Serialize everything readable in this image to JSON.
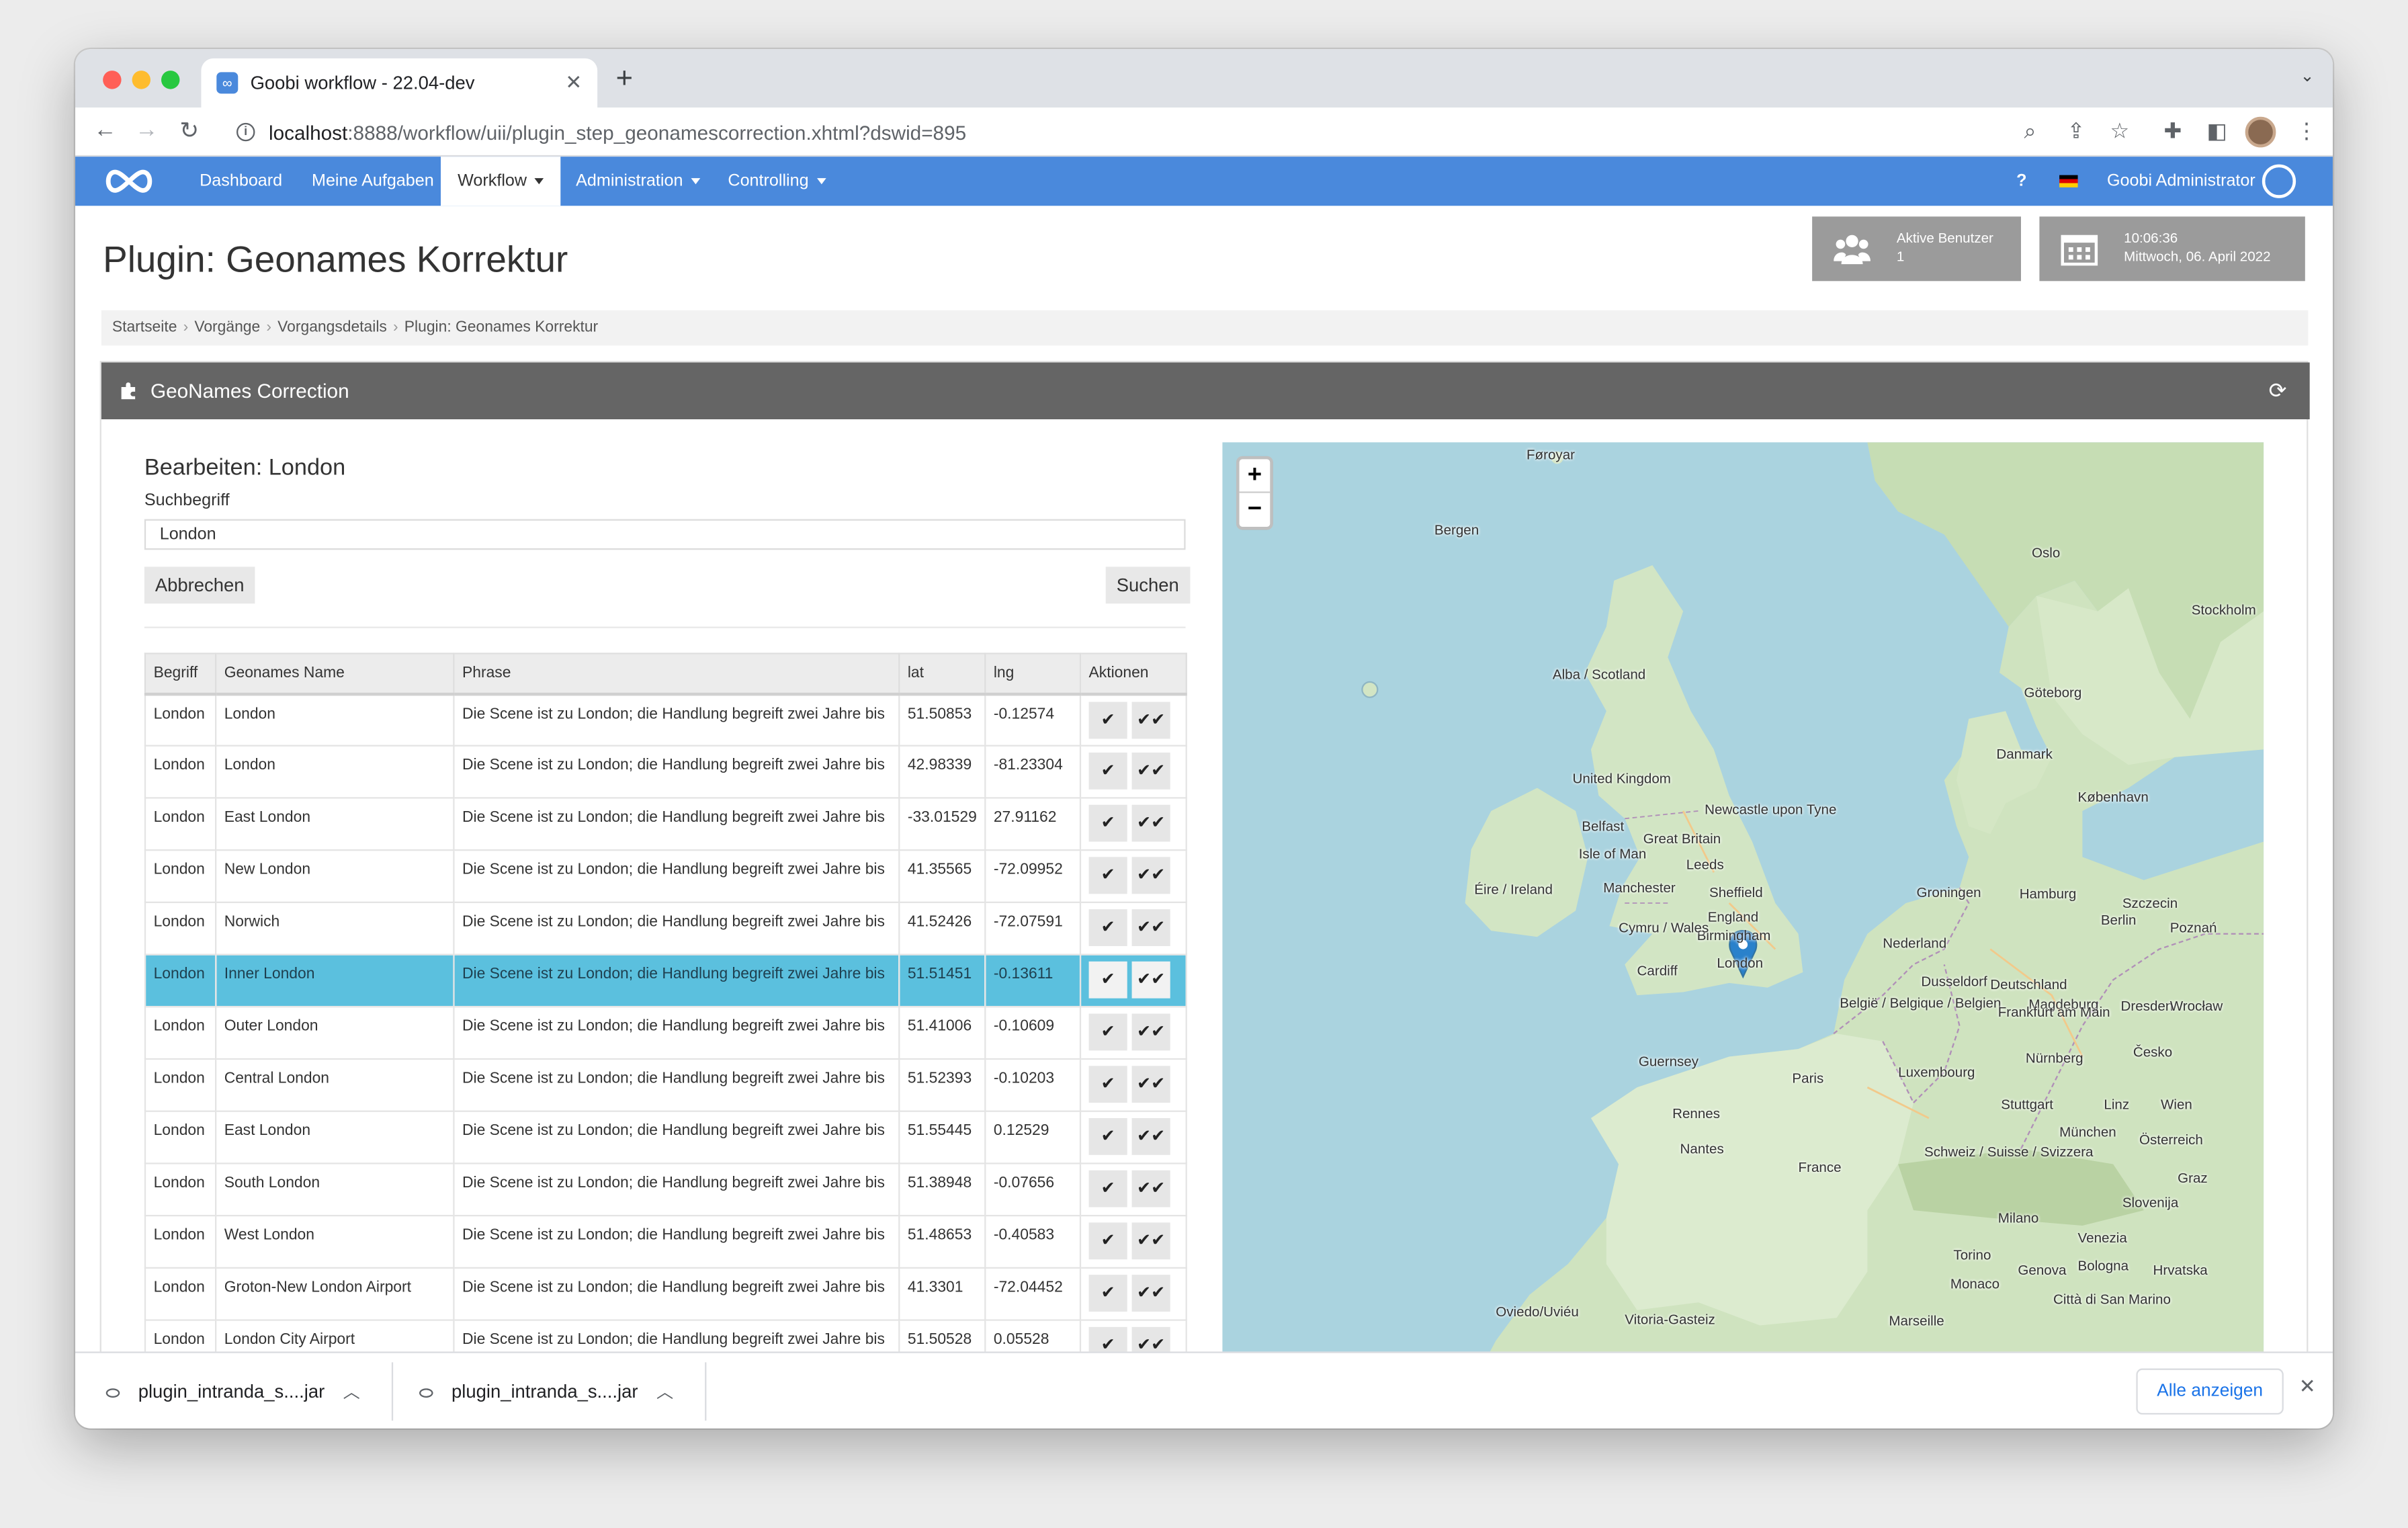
{
  "browser": {
    "tab_title": "Goobi workflow - 22.04-dev",
    "favicon_text": "∞",
    "url_host": "localhost",
    "url_path": ":8888/workflow/uii/plugin_step_geonamescorrection.xhtml?dswid=895"
  },
  "navbar": {
    "items": [
      {
        "label": "Dashboard"
      },
      {
        "label": "Meine Aufgaben"
      },
      {
        "label": "Workflow"
      },
      {
        "label": "Administration"
      },
      {
        "label": "Controlling"
      }
    ],
    "help": "?",
    "user": "Goobi Administrator"
  },
  "header": {
    "title": "Plugin: Geonames Korrektur",
    "active_users_label": "Aktive Benutzer",
    "active_users_count": "1",
    "time": "10:06:36",
    "date": "Mittwoch, 06. April 2022"
  },
  "breadcrumb": [
    "Startseite",
    "Vorgänge",
    "Vorgangsdetails",
    "Plugin: Geonames Korrektur"
  ],
  "panel": {
    "title": "GeoNames Correction",
    "edit_title": "Bearbeiten: London",
    "search_label": "Suchbegriff",
    "search_value": "London",
    "cancel_label": "Abbrechen",
    "search_button": "Suchen"
  },
  "table": {
    "headers": [
      "Begriff",
      "Geonames Name",
      "Phrase",
      "lat",
      "lng",
      "Aktionen"
    ],
    "rows": [
      {
        "term": "London",
        "name": "London",
        "phrase": "Die Scene ist zu London; die Handlung begreift zwei Jahre bis",
        "lat": "51.50853",
        "lng": "-0.12574"
      },
      {
        "term": "London",
        "name": "London",
        "phrase": "Die Scene ist zu London; die Handlung begreift zwei Jahre bis",
        "lat": "42.98339",
        "lng": "-81.23304"
      },
      {
        "term": "London",
        "name": "East London",
        "phrase": "Die Scene ist zu London; die Handlung begreift zwei Jahre bis",
        "lat": "-33.01529",
        "lng": "27.91162"
      },
      {
        "term": "London",
        "name": "New London",
        "phrase": "Die Scene ist zu London; die Handlung begreift zwei Jahre bis",
        "lat": "41.35565",
        "lng": "-72.09952"
      },
      {
        "term": "London",
        "name": "Norwich",
        "phrase": "Die Scene ist zu London; die Handlung begreift zwei Jahre bis",
        "lat": "41.52426",
        "lng": "-72.07591"
      },
      {
        "term": "London",
        "name": "Inner London",
        "phrase": "Die Scene ist zu London; die Handlung begreift zwei Jahre bis",
        "lat": "51.51451",
        "lng": "-0.13611",
        "selected": true
      },
      {
        "term": "London",
        "name": "Outer London",
        "phrase": "Die Scene ist zu London; die Handlung begreift zwei Jahre bis",
        "lat": "51.41006",
        "lng": "-0.10609"
      },
      {
        "term": "London",
        "name": "Central London",
        "phrase": "Die Scene ist zu London; die Handlung begreift zwei Jahre bis",
        "lat": "51.52393",
        "lng": "-0.10203"
      },
      {
        "term": "London",
        "name": "East London",
        "phrase": "Die Scene ist zu London; die Handlung begreift zwei Jahre bis",
        "lat": "51.55445",
        "lng": "0.12529"
      },
      {
        "term": "London",
        "name": "South London",
        "phrase": "Die Scene ist zu London; die Handlung begreift zwei Jahre bis",
        "lat": "51.38948",
        "lng": "-0.07656"
      },
      {
        "term": "London",
        "name": "West London",
        "phrase": "Die Scene ist zu London; die Handlung begreift zwei Jahre bis",
        "lat": "51.48653",
        "lng": "-0.40583"
      },
      {
        "term": "London",
        "name": "Groton-New London Airport",
        "phrase": "Die Scene ist zu London; die Handlung begreift zwei Jahre bis",
        "lat": "41.3301",
        "lng": "-72.04452"
      },
      {
        "term": "London",
        "name": "London City Airport",
        "phrase": "Die Scene ist zu London; die Handlung begreift zwei Jahre bis",
        "lat": "51.50528",
        "lng": "0.05528"
      }
    ],
    "action_single": "✔",
    "action_all": "✔✔"
  },
  "map": {
    "zoom_in": "+",
    "zoom_out": "−",
    "labels": [
      "Føroyar",
      "Bergen",
      "Oslo",
      "Stockholm",
      "Göteborg",
      "Alba / Scotland",
      "Danmark",
      "København",
      "United Kingdom",
      "Newcastle upon Tyne",
      "Belfast",
      "Great Britain",
      "Isle of Man",
      "Éire / Ireland",
      "Manchester",
      "Leeds",
      "Sheffield",
      "Hamburg",
      "Groningen",
      "Szczecin",
      "Berlin",
      "Poznań",
      "England",
      "Birmingham",
      "Cymru / Wales",
      "Cardiff",
      "London",
      "Nederland",
      "Dusseldorf",
      "Deutschland",
      "Magdeburg",
      "België / Belgique / Belgien",
      "Frankfurt am Main",
      "Dresden",
      "Wrocław",
      "Guernsey",
      "Paris",
      "Luxembourg",
      "Nürnberg",
      "Česko",
      "Rennes",
      "Stuttgart",
      "München",
      "Linz",
      "Wien",
      "Nantes",
      "France",
      "Österreich",
      "Schweiz / Suisse / Svizzera",
      "Graz",
      "Slovenija",
      "Milano",
      "Venezia",
      "Torino",
      "Genova",
      "Bologna",
      "Hrvatska",
      "Monaco",
      "Città di San Marino",
      "Marseille",
      "Oviedo/Uviéu",
      "Vitoria-Gasteiz"
    ],
    "marker": "London"
  },
  "downloads": {
    "items": [
      "plugin_intranda_s....jar",
      "plugin_intranda_s....jar"
    ],
    "show_all": "Alle anzeigen",
    "close": "✕"
  }
}
